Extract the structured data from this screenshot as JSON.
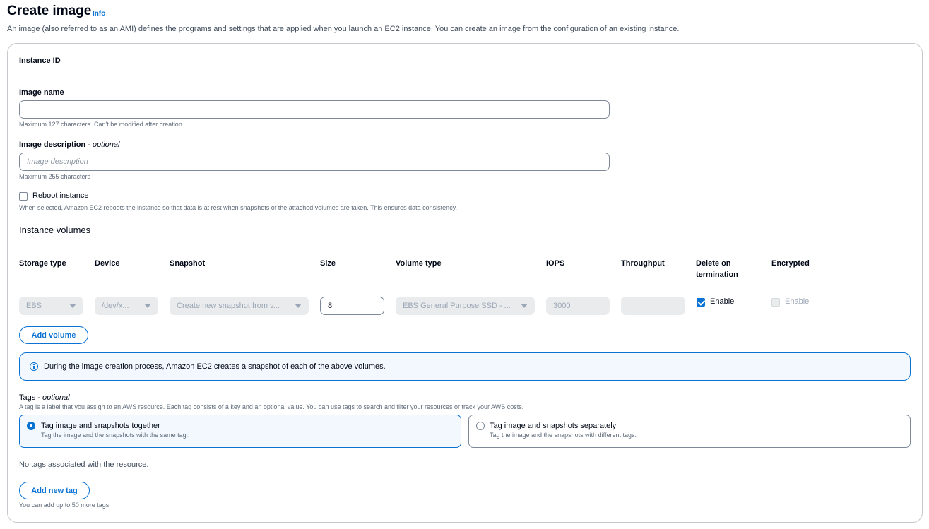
{
  "header": {
    "title": "Create image",
    "info_link": "Info",
    "description": "An image (also referred to as an AMI) defines the programs and settings that are applied when you launch an EC2 instance. You can create an image from the configuration of an existing instance."
  },
  "form": {
    "instance_id_label": "Instance ID",
    "image_name": {
      "label": "Image name",
      "value": "",
      "hint": "Maximum 127 characters. Can't be modified after creation."
    },
    "image_description": {
      "label": "Image description",
      "label_suffix": "optional",
      "placeholder": "Image description",
      "hint": "Maximum 255 characters"
    },
    "reboot": {
      "label": "Reboot instance",
      "checked": false,
      "hint": "When selected, Amazon EC2 reboots the instance so that data is at rest when snapshots of the attached volumes are taken. This ensures data consistency."
    }
  },
  "volumes": {
    "heading": "Instance volumes",
    "columns": {
      "storage_type": "Storage type",
      "device": "Device",
      "snapshot": "Snapshot",
      "size": "Size",
      "volume_type": "Volume type",
      "iops": "IOPS",
      "throughput": "Throughput",
      "delete_on_termination": "Delete on termination",
      "encrypted": "Encrypted"
    },
    "row": {
      "storage_type": "EBS",
      "device": "/dev/x...",
      "snapshot": "Create new snapshot from v...",
      "size": "8",
      "volume_type": "EBS General Purpose SSD - ...",
      "iops": "3000",
      "throughput": "",
      "delete_on_termination_label": "Enable",
      "delete_on_termination_checked": true,
      "encrypted_label": "Enable",
      "encrypted_checked": false
    },
    "add_volume_button": "Add volume",
    "alert": "During the image creation process, Amazon EC2 creates a snapshot of each of the above volumes."
  },
  "tags": {
    "label": "Tags",
    "label_suffix": "optional",
    "description": "A tag is a label that you assign to an AWS resource. Each tag consists of a key and an optional value. You can use tags to search and filter your resources or track your AWS costs.",
    "options": [
      {
        "title": "Tag image and snapshots together",
        "description": "Tag the image and the snapshots with the same tag.",
        "selected": true
      },
      {
        "title": "Tag image and snapshots separately",
        "description": "Tag the image and the snapshots with different tags.",
        "selected": false
      }
    ],
    "empty_text": "No tags associated with the resource.",
    "add_tag_button": "Add new tag",
    "limit_hint": "You can add up to 50 more tags."
  },
  "colors": {
    "primary": "#0972d3",
    "text": "#000716",
    "disabled_bg": "#e9ebed",
    "alert_bg": "#f2f8fd"
  }
}
